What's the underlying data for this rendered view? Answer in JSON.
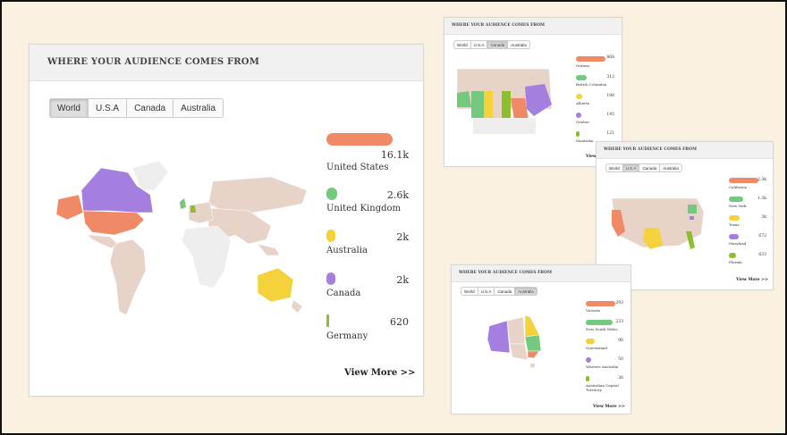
{
  "main_widget": {
    "title": "WHERE YOUR AUDIENCE COMES FROM",
    "tabs": [
      "World",
      "U.S.A",
      "Canada",
      "Australia"
    ],
    "active_tab": "World",
    "legend": [
      {
        "label": "United States",
        "value": "16.1k",
        "color": "#f08a66"
      },
      {
        "label": "United Kingdom",
        "value": "2.6k",
        "color": "#74c97f"
      },
      {
        "label": "Australia",
        "value": "2k",
        "color": "#f5d23c"
      },
      {
        "label": "Canada",
        "value": "2k",
        "color": "#a47fe0"
      },
      {
        "label": "Germany",
        "value": "620",
        "color": "#8cbe2e"
      }
    ],
    "view_more": "View More >>"
  },
  "canada_widget": {
    "title": "WHERE YOUR AUDIENCE COMES FROM",
    "tabs": [
      "World",
      "U.S.A",
      "Canada",
      "Australia"
    ],
    "active_tab": "Canada",
    "legend": [
      {
        "label": "Ontario",
        "value": "868",
        "color": "#f08a66"
      },
      {
        "label": "British Columbia",
        "value": "312",
        "color": "#74c97f"
      },
      {
        "label": "Alberta",
        "value": "198",
        "color": "#f5d23c"
      },
      {
        "label": "Quebec",
        "value": "145",
        "color": "#a47fe0"
      },
      {
        "label": "Manitoba",
        "value": "121",
        "color": "#8cbe2e"
      }
    ],
    "view_more": "View M"
  },
  "usa_widget": {
    "title": "WHERE YOUR AUDIENCE COMES FROM",
    "tabs": [
      "World",
      "U.S.A",
      "Canada",
      "Australia"
    ],
    "active_tab": "U.S.A",
    "legend": [
      {
        "label": "California",
        "value": "2.3k",
        "color": "#f08a66"
      },
      {
        "label": "New York",
        "value": "1.3k",
        "color": "#74c97f"
      },
      {
        "label": "Texas",
        "value": "3k",
        "color": "#f5d23c"
      },
      {
        "label": "Maryland",
        "value": "672",
        "color": "#a47fe0"
      },
      {
        "label": "Florida",
        "value": "633",
        "color": "#8cbe2e"
      }
    ],
    "view_more": "View More >>"
  },
  "australia_widget": {
    "title": "WHERE YOUR AUDIENCE COMES FROM",
    "tabs": [
      "World",
      "U.S.A",
      "Canada",
      "Australia"
    ],
    "active_tab": "Australia",
    "legend": [
      {
        "label": "Victoria",
        "value": "293",
        "color": "#f08a66"
      },
      {
        "label": "New South Wales",
        "value": "233",
        "color": "#74c97f"
      },
      {
        "label": "Queensland",
        "value": "96",
        "color": "#f5d23c"
      },
      {
        "label": "Western Australia",
        "value": "50",
        "color": "#a47fe0"
      },
      {
        "label": "Australian Capital Territory",
        "value": "36",
        "color": "#8cbe2e"
      }
    ],
    "view_more": "View More >>"
  },
  "colors": {
    "background": "#fbf1e0",
    "land": "#e8d3c8",
    "land_unused": "#eeeeee"
  }
}
